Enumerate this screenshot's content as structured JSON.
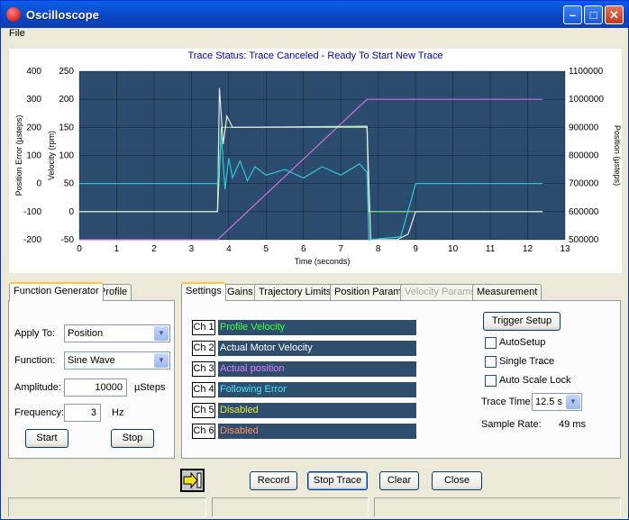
{
  "window": {
    "title": "Oscilloscope"
  },
  "menu": {
    "file": "File"
  },
  "trace_status": "Trace Status:  Trace Canceled - Ready To Start New Trace",
  "chart_data": {
    "type": "line",
    "xlabel": "Time (seconds)",
    "x_ticks": [
      "0",
      "1",
      "2",
      "3",
      "4",
      "5",
      "6",
      "7",
      "8",
      "9",
      "10",
      "11",
      "12",
      "13"
    ],
    "xlim": [
      0,
      13
    ],
    "left_axis_pos_err": {
      "label": "Position Error (µsteps)",
      "ticks": [
        "400",
        "300",
        "200",
        "100",
        "0",
        "-100",
        "-200"
      ],
      "range": [
        -200,
        400
      ]
    },
    "left_axis_vel": {
      "label": "Velocity (rpm)",
      "ticks": [
        "250",
        "200",
        "150",
        "100",
        "50",
        "0",
        "-50"
      ],
      "range": [
        -50,
        250
      ]
    },
    "right_axis": {
      "label": "Position (µsteps)",
      "ticks": [
        "1100000",
        "1000000",
        "900000",
        "800000",
        "700000",
        "600000",
        "500000"
      ],
      "range": [
        500000,
        1100000
      ]
    },
    "grid": true,
    "background": "#2b4c6f",
    "series": [
      {
        "color": "#d070e0",
        "axis": "position",
        "points": [
          [
            0,
            500000
          ],
          [
            3.7,
            500000
          ],
          [
            7.7,
            1000000
          ],
          [
            12.4,
            1000000
          ]
        ]
      },
      {
        "color": "#90f090",
        "axis": "velocity",
        "points": [
          [
            0,
            0
          ],
          [
            3.7,
            0
          ],
          [
            3.8,
            150
          ],
          [
            7.7,
            150
          ],
          [
            7.75,
            0
          ],
          [
            12.4,
            0
          ]
        ]
      },
      {
        "color": "#e8e8e8",
        "axis": "velocity",
        "points": [
          [
            0,
            0
          ],
          [
            3.7,
            0
          ],
          [
            3.75,
            220
          ],
          [
            3.85,
            120
          ],
          [
            3.95,
            170
          ],
          [
            4.1,
            150
          ],
          [
            7.7,
            152
          ],
          [
            7.8,
            -50
          ],
          [
            8.5,
            -50
          ],
          [
            8.8,
            -40
          ],
          [
            9.0,
            0
          ],
          [
            12.4,
            0
          ]
        ]
      },
      {
        "color": "#30c8d8",
        "axis": "pos_err",
        "points": [
          [
            0,
            0
          ],
          [
            3.7,
            0
          ],
          [
            3.8,
            170
          ],
          [
            3.9,
            -20
          ],
          [
            4.0,
            90
          ],
          [
            4.1,
            20
          ],
          [
            4.3,
            80
          ],
          [
            4.5,
            10
          ],
          [
            4.7,
            60
          ],
          [
            5.0,
            30
          ],
          [
            5.5,
            50
          ],
          [
            6.0,
            20
          ],
          [
            6.5,
            60
          ],
          [
            7.0,
            30
          ],
          [
            7.5,
            70
          ],
          [
            7.7,
            40
          ],
          [
            7.75,
            -200
          ],
          [
            8.6,
            -190
          ],
          [
            8.9,
            -50
          ],
          [
            9.0,
            0
          ],
          [
            12.4,
            0
          ]
        ]
      }
    ]
  },
  "left_tabs": [
    {
      "label": "Function Generator",
      "active": true
    },
    {
      "label": "Profile",
      "active": false
    }
  ],
  "func_gen": {
    "apply_to_label": "Apply To:",
    "apply_to_value": "Position",
    "function_label": "Function:",
    "function_value": "Sine Wave",
    "amplitude_label": "Amplitude:",
    "amplitude_value": "10000",
    "amplitude_unit": "µSteps",
    "frequency_label": "Frequency:",
    "frequency_value": "3",
    "frequency_unit": "Hz",
    "start": "Start",
    "stop": "Stop"
  },
  "right_tabs": [
    {
      "label": "Settings",
      "state": "active"
    },
    {
      "label": "Gains",
      "state": "normal"
    },
    {
      "label": "Trajectory Limits",
      "state": "normal"
    },
    {
      "label": "Position Params",
      "state": "normal"
    },
    {
      "label": "Velocity Params",
      "state": "disabled"
    },
    {
      "label": "Measurement",
      "state": "normal"
    }
  ],
  "channels": [
    {
      "label": "Ch 1",
      "value": "Profile Velocity",
      "color": "#40ff40"
    },
    {
      "label": "Ch 2",
      "value": "Actual Motor Velocity",
      "color": "#ffffff"
    },
    {
      "label": "Ch 3",
      "value": "Actual position",
      "color": "#e080ff"
    },
    {
      "label": "Ch 4",
      "value": "Following Error",
      "color": "#40e8ff"
    },
    {
      "label": "Ch 5",
      "value": "Disabled",
      "color": "#e8e840"
    },
    {
      "label": "Ch 6",
      "value": "Disabled",
      "color": "#ff9060"
    }
  ],
  "settings": {
    "trigger_setup": "Trigger Setup",
    "autosetup": "AutoSetup",
    "single_trace": "Single Trace",
    "auto_scale_lock": "Auto Scale Lock",
    "trace_time_label": "Trace Time:",
    "trace_time_value": "12.5 s",
    "sample_rate_label": "Sample Rate:",
    "sample_rate_value": "49 ms"
  },
  "bottom_buttons": {
    "record": "Record",
    "stop_trace": "Stop Trace",
    "clear": "Clear",
    "close": "Close"
  }
}
